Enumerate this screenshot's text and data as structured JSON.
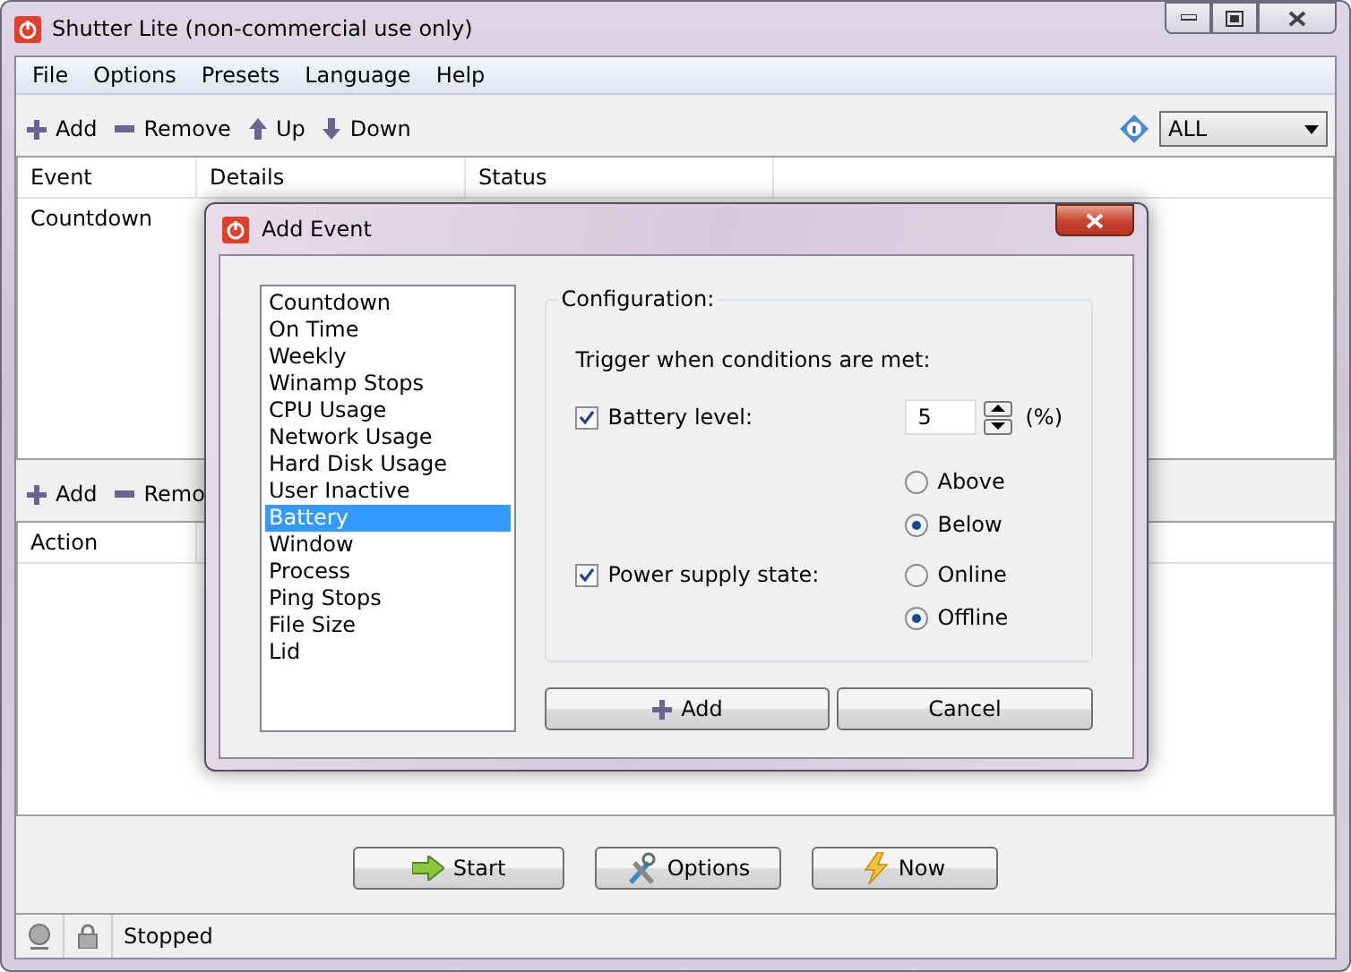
{
  "window": {
    "title": "Shutter Lite (non-commercial use only)"
  },
  "menu": [
    "File",
    "Options",
    "Presets",
    "Language",
    "Help"
  ],
  "toolbar": [
    {
      "kind": "add",
      "label": "Add"
    },
    {
      "kind": "remove",
      "label": "Remove"
    },
    {
      "kind": "up",
      "label": "Up"
    },
    {
      "kind": "down",
      "label": "Down"
    }
  ],
  "filter": {
    "value": "ALL"
  },
  "events_table": {
    "columns": [
      "Event",
      "Details",
      "Status"
    ],
    "rows": [
      [
        "Countdown"
      ]
    ]
  },
  "actions_toolbar": [
    {
      "kind": "add",
      "label": "Add"
    },
    {
      "kind": "remove",
      "label": "Remo"
    }
  ],
  "actions_table": {
    "columns": [
      "Action"
    ]
  },
  "buttons": [
    {
      "kind": "start",
      "label": "Start"
    },
    {
      "kind": "options",
      "label": "Options"
    },
    {
      "kind": "now",
      "label": "Now"
    }
  ],
  "status_bar": {
    "text": "Stopped"
  },
  "dialog": {
    "title": "Add Event",
    "events": [
      {
        "label": "Countdown",
        "selected": false
      },
      {
        "label": "On Time",
        "selected": false
      },
      {
        "label": "Weekly",
        "selected": false
      },
      {
        "label": "Winamp Stops",
        "selected": false
      },
      {
        "label": "CPU Usage",
        "selected": false
      },
      {
        "label": "Network Usage",
        "selected": false
      },
      {
        "label": "Hard Disk Usage",
        "selected": false
      },
      {
        "label": "User Inactive",
        "selected": false
      },
      {
        "label": "Battery",
        "selected": true
      },
      {
        "label": "Window",
        "selected": false
      },
      {
        "label": "Process",
        "selected": false
      },
      {
        "label": "Ping Stops",
        "selected": false
      },
      {
        "label": "File Size",
        "selected": false
      },
      {
        "label": "Lid",
        "selected": false
      }
    ],
    "group": "Configuration:",
    "prompt": "Trigger when conditions are met:",
    "battery": {
      "label": "Battery level:",
      "checked": true,
      "value": "5",
      "unit": "(%)",
      "options": [
        {
          "label": "Above",
          "selected": false
        },
        {
          "label": "Below",
          "selected": true
        }
      ]
    },
    "power": {
      "label": "Power supply state:",
      "checked": true,
      "options": [
        {
          "label": "Online",
          "selected": false
        },
        {
          "label": "Offline",
          "selected": true
        }
      ]
    },
    "buttons": [
      {
        "kind": "add",
        "label": "Add"
      },
      {
        "kind": "cancel",
        "label": "Cancel"
      }
    ]
  }
}
